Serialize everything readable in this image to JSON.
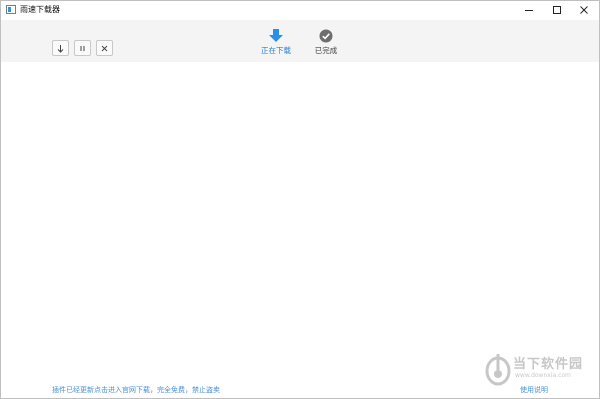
{
  "window": {
    "title": "雨速下载器",
    "controls": {
      "minimize_icon": "minimize-icon",
      "maximize_icon": "maximize-icon",
      "close_icon": "close-icon"
    }
  },
  "toolbar": {
    "buttons": [
      {
        "name": "start-download-button",
        "icon": "arrow-down-icon"
      },
      {
        "name": "pause-button",
        "icon": "pause-icon"
      },
      {
        "name": "delete-button",
        "icon": "close-icon"
      }
    ],
    "tabs": [
      {
        "label": "正在下载",
        "icon": "download-arrow-icon",
        "active": true
      },
      {
        "label": "已完成",
        "icon": "check-circle-icon",
        "active": false
      }
    ]
  },
  "footer": {
    "notice": "插件已经更新点击进入官网下载，完全免费，禁止盗卖",
    "help_link": "使用说明"
  },
  "watermark": {
    "name_cn": "当下软件园",
    "url": "www.downxia.com"
  },
  "colors": {
    "accent": "#2a7fd4",
    "link": "#4a8fd6",
    "toolbar_bg": "#f4f4f4"
  }
}
